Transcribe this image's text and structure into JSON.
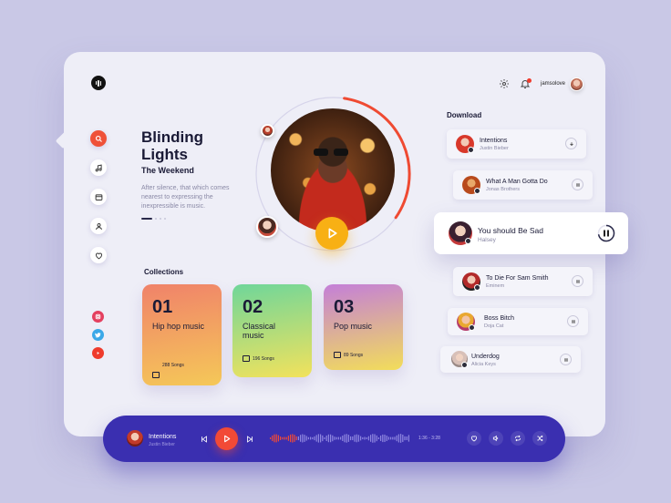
{
  "header": {
    "username": "jamsolove",
    "icons": [
      "logo-icon",
      "settings-icon",
      "bell-icon"
    ]
  },
  "sidebar": {
    "nav": [
      {
        "icon": "search-icon",
        "active": true
      },
      {
        "icon": "music-note-icon",
        "active": false
      },
      {
        "icon": "library-icon",
        "active": false
      },
      {
        "icon": "user-icon",
        "active": false
      },
      {
        "icon": "heart-icon",
        "active": false
      }
    ],
    "social": [
      {
        "icon": "instagram-icon",
        "color": "#e4405f"
      },
      {
        "icon": "twitter-icon",
        "color": "#3aa8e8"
      },
      {
        "icon": "youtube-icon",
        "color": "#ef3b2c"
      }
    ]
  },
  "featured": {
    "title": "Blinding Lights",
    "artist": "The Weekend",
    "description": "After silence, that which comes nearest to expressing the inexpressible is music.",
    "progress": 0.62
  },
  "collections": {
    "heading": "Collections",
    "items": [
      {
        "number": "01",
        "name": "Hip hop music",
        "songs": "288 Songs",
        "gradient": [
          "#f0826a",
          "#f5c858"
        ]
      },
      {
        "number": "02",
        "name": "Classical music",
        "songs": "196 Songs",
        "gradient": [
          "#6fd69a",
          "#f2e25c"
        ]
      },
      {
        "number": "03",
        "name": "Pop music",
        "songs": "89 Songs",
        "gradient": [
          "#c47fd8",
          "#f2dd5a"
        ]
      }
    ]
  },
  "download": {
    "heading": "Download",
    "items": [
      {
        "title": "Intentions",
        "artist": "Justin Bieber",
        "state": "download"
      },
      {
        "title": "What A Man Gotta Do",
        "artist": "Jonas Brothers",
        "state": "pause"
      },
      {
        "title": "You should Be Sad",
        "artist": "Halsey",
        "state": "pause-active"
      },
      {
        "title": "To Die For Sam Smith",
        "artist": "Eminem",
        "state": "pause"
      },
      {
        "title": "Boss Bitch",
        "artist": "Doja Cat",
        "state": "pause"
      },
      {
        "title": "Underdog",
        "artist": "Alicia Keys",
        "state": "pause"
      }
    ]
  },
  "player": {
    "title": "Intentions",
    "artist": "Justin Bieber",
    "time": "1:36 - 3:28",
    "progress": 0.2,
    "accent": "#3a2fb0",
    "play_color": "#f24a36"
  }
}
